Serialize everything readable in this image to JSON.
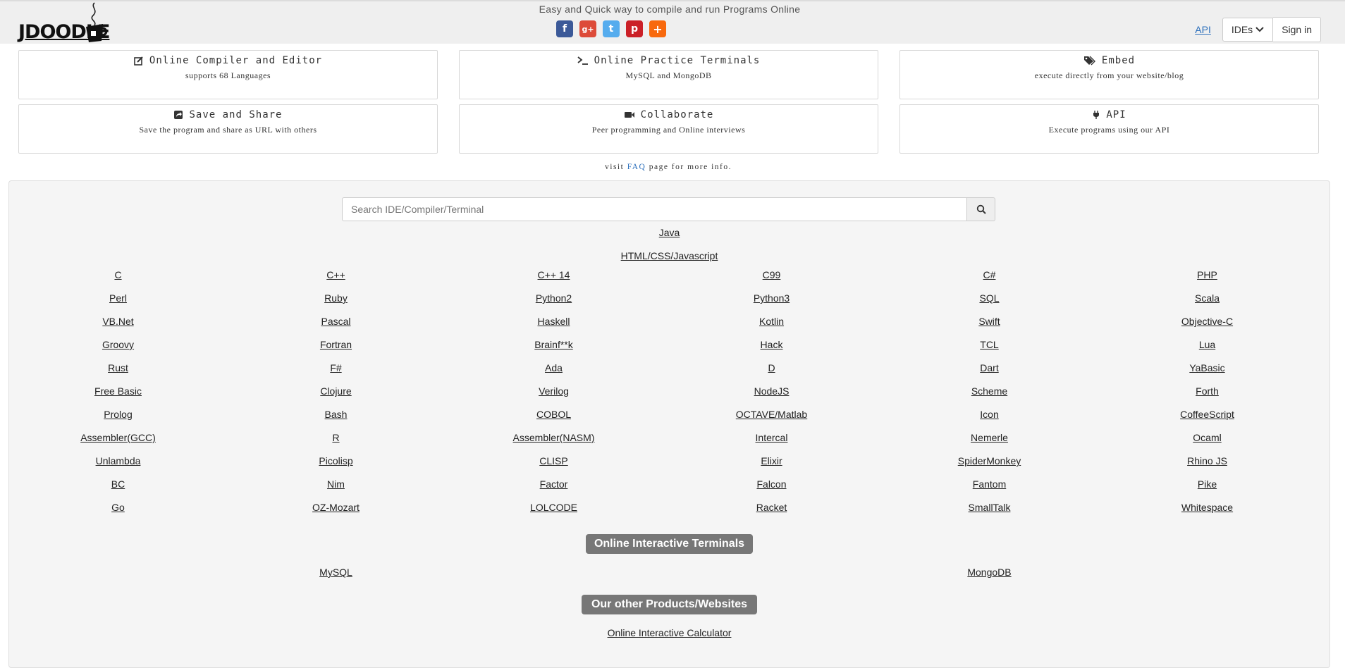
{
  "header": {
    "logo_text": "JDOODLE",
    "tagline": "Easy and Quick way to compile and run Programs Online",
    "social": [
      {
        "name": "facebook",
        "glyph": "f",
        "color": "#3b5998"
      },
      {
        "name": "google-plus",
        "glyph": "g+",
        "color": "#dd4b39"
      },
      {
        "name": "twitter",
        "glyph": "t",
        "color": "#55acee"
      },
      {
        "name": "pinterest",
        "glyph": "p",
        "color": "#cb2027"
      },
      {
        "name": "addthis",
        "glyph": "+",
        "color": "#f8690d"
      }
    ],
    "api_label": "API",
    "ides_label": "IDEs",
    "signin_label": "Sign in"
  },
  "features": [
    {
      "icon": "edit-icon",
      "title": "Online Compiler and Editor",
      "subtitle": "supports 68 Languages"
    },
    {
      "icon": "terminal-icon",
      "title": "Online Practice Terminals",
      "subtitle": "MySQL and MongoDB"
    },
    {
      "icon": "tags-icon",
      "title": "Embed",
      "subtitle": "execute directly from your website/blog"
    },
    {
      "icon": "share-icon",
      "title": "Save and Share",
      "subtitle": "Save the program and share as URL with others"
    },
    {
      "icon": "video-camera-icon",
      "title": "Collaborate",
      "subtitle": "Peer programming and Online interviews"
    },
    {
      "icon": "plug-icon",
      "title": "API",
      "subtitle": "Execute programs using our API"
    }
  ],
  "faq": {
    "prefix": "visit",
    "link": "FAQ",
    "suffix": "page for more info."
  },
  "search": {
    "placeholder": "Search IDE/Compiler/Terminal"
  },
  "featured_langs": [
    "Java",
    "HTML/CSS/Javascript"
  ],
  "languages": [
    "C",
    "C++",
    "C++ 14",
    "C99",
    "C#",
    "PHP",
    "Perl",
    "Ruby",
    "Python2",
    "Python3",
    "SQL",
    "Scala",
    "VB.Net",
    "Pascal",
    "Haskell",
    "Kotlin",
    "Swift",
    "Objective-C",
    "Groovy",
    "Fortran",
    "Brainf**k",
    "Hack",
    "TCL",
    "Lua",
    "Rust",
    "F#",
    "Ada",
    "D",
    "Dart",
    "YaBasic",
    "Free Basic",
    "Clojure",
    "Verilog",
    "NodeJS",
    "Scheme",
    "Forth",
    "Prolog",
    "Bash",
    "COBOL",
    "OCTAVE/Matlab",
    "Icon",
    "CoffeeScript",
    "Assembler(GCC)",
    "R",
    "Assembler(NASM)",
    "Intercal",
    "Nemerle",
    "Ocaml",
    "Unlambda",
    "Picolisp",
    "CLISP",
    "Elixir",
    "SpiderMonkey",
    "Rhino JS",
    "BC",
    "Nim",
    "Factor",
    "Falcon",
    "Fantom",
    "Pike",
    "Go",
    "OZ-Mozart",
    "LOLCODE",
    "Racket",
    "SmallTalk",
    "Whitespace"
  ],
  "terminals": {
    "heading": "Online Interactive Terminals",
    "items": [
      "MySQL",
      "MongoDB"
    ]
  },
  "products": {
    "heading": "Our other Products/Websites",
    "items": [
      "Online Interactive Calculator"
    ]
  }
}
